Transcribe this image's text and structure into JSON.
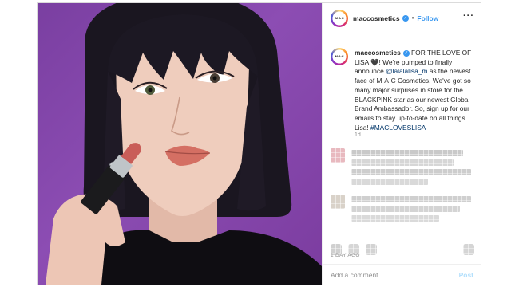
{
  "post": {
    "account": {
      "username": "maccosmetics",
      "verified_glyph": "✓",
      "avatar_mark": "M·A·C",
      "separator": "•",
      "follow_label": "Follow",
      "more_glyph": "···"
    },
    "caption": {
      "username": "maccosmetics",
      "text_part1": " FOR THE LOVE OF LISA ",
      "heart_glyph": "🖤",
      "text_part2": "! We're pumped to finally announce ",
      "mention": "@lalalalisa_m",
      "text_part3": " as the newest face of M·A·C Cosmetics. We've got so many major surprises in store for the BLACKPINK star as our newest Global Brand Ambassador. So, sign up for our emails to stay up-to-date on all things Lisa! ",
      "hashtag": "#MACLOVESLISA",
      "time": "1d"
    },
    "post_age": "1 DAY AGO",
    "add_comment": {
      "placeholder": "Add a comment…",
      "post_label": "Post"
    },
    "colors": {
      "background_purple": "#8c4db3",
      "link_blue": "#3897f0",
      "hashtag_blue": "#003569",
      "muted_gray": "#8e8e8e",
      "post_disabled": "#b2dffc"
    },
    "icons": [
      "more-options-icon",
      "verified-badge-icon",
      "like-icon",
      "comment-icon",
      "share-icon",
      "save-icon"
    ]
  }
}
